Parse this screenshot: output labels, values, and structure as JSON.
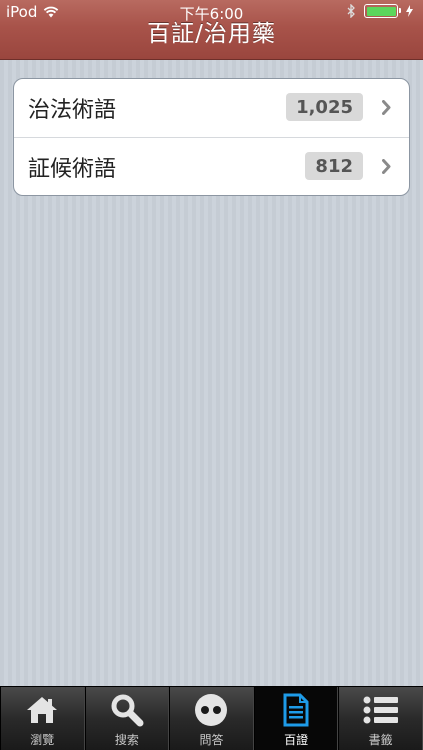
{
  "status": {
    "carrier": "iPod",
    "time": "下午6:00",
    "battery_level": 1.0,
    "battery_color": "#5cd65c"
  },
  "nav": {
    "title": "百証/治用藥",
    "bar_color": "#a8534a"
  },
  "list": {
    "items": [
      {
        "label": "治法術語",
        "count": "1,025"
      },
      {
        "label": "証候術語",
        "count": "812"
      }
    ]
  },
  "tabbar": {
    "tabs": [
      {
        "label": "瀏覽",
        "icon": "home-icon",
        "active": false
      },
      {
        "label": "搜索",
        "icon": "search-icon",
        "active": false
      },
      {
        "label": "問答",
        "icon": "qa-icon",
        "active": false
      },
      {
        "label": "百證",
        "icon": "document-icon",
        "active": true
      },
      {
        "label": "書籤",
        "icon": "list-icon",
        "active": false
      }
    ],
    "active_color": "#1e9be8"
  }
}
